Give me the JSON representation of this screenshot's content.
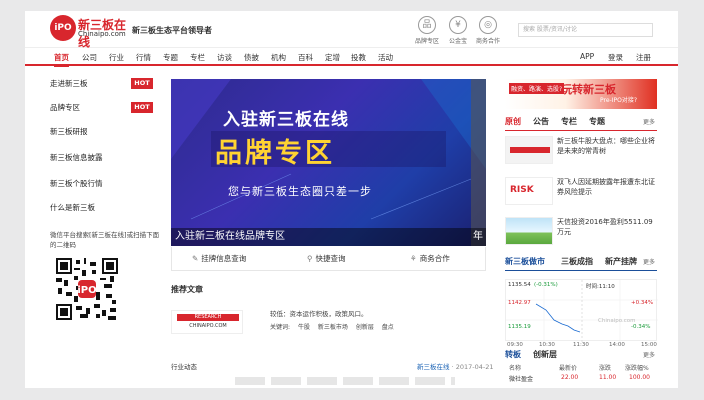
{
  "header": {
    "logo_badge": "iPO",
    "logo_cn": "新三板在线",
    "logo_en": "Chinaipo.com",
    "slogan": "新三板生态平台领导者",
    "icons": [
      {
        "name": "brand-icon",
        "glyph": "品",
        "label": "品牌专区"
      },
      {
        "name": "public-fund-icon",
        "glyph": "¥",
        "label": "公金宝"
      },
      {
        "name": "business-icon",
        "glyph": "◎",
        "label": "商务合作"
      }
    ],
    "search_placeholder": "搜索 股票/资讯/讨论"
  },
  "nav": {
    "items": [
      "首页",
      "公司",
      "行业",
      "行情",
      "专题",
      "专栏",
      "访谈",
      "债披",
      "机构",
      "百科",
      "定增",
      "投教",
      "活动"
    ],
    "right": [
      "APP",
      "登录",
      "注册"
    ]
  },
  "sidebar": {
    "items": [
      {
        "label": "走进新三板",
        "hot": true
      },
      {
        "label": "品牌专区",
        "hot": true
      },
      {
        "label": "新三板研报",
        "hot": false
      },
      {
        "label": "新三板信息披露",
        "hot": false
      },
      {
        "label": "新三板个股行情",
        "hot": false
      },
      {
        "label": "什么是新三板",
        "hot": false
      }
    ],
    "hot_label": "HOT",
    "wechat_note": "微信平台搜索[新三板在线]或扫描下面的二维码"
  },
  "banner": {
    "line1": "入驻新三板在线",
    "line2": "品牌专区",
    "line3": "您与新三板生态圈只差一步",
    "caption": "入驻新三板在线品牌专区",
    "caption_next": "年"
  },
  "actions": [
    {
      "icon": "✎",
      "label": "挂牌信息查询"
    },
    {
      "icon": "⚲",
      "label": "快捷查询"
    },
    {
      "icon": "⚘",
      "label": "商务合作"
    }
  ],
  "recommended": {
    "title": "推荐文章",
    "image_top": "RESEARCH",
    "image_bottom": "CHINAIPO.COM",
    "text": "较低：资本运作积极，政策风口。",
    "keywords_label": "关键词:",
    "keywords": [
      "牛股",
      "新三板市场",
      "创新层",
      "盘点"
    ]
  },
  "industry": {
    "title": "行业动态",
    "source": "新三板在线",
    "date": "2017-04-21"
  },
  "right": {
    "ad": {
      "tag": "融资、路演、选股?",
      "main": "玩转新三板",
      "sub": "Pre-IPO对接?"
    },
    "tabs": [
      "原创",
      "公告",
      "专栏",
      "专题"
    ],
    "more": "更多",
    "news": [
      {
        "title": "新三板牛股大盘点：哪些企业将是未来的常青树"
      },
      {
        "title": "双飞人因延期披露年报遭东北证券风险提示",
        "image_label": "RISK"
      },
      {
        "title": "天信投资2016年盈利5511.09万元"
      }
    ],
    "market_tabs": [
      "新三板做市",
      "三板成指",
      "新产挂牌"
    ],
    "stock": {
      "points": "1135.54",
      "change": "(-0.31%)",
      "time": "时间:11:10",
      "high": "1142.97",
      "low": "1135.19",
      "pct_high": "+0.34%",
      "pct_low": "-0.34%",
      "watermark": "Chinaipo.com",
      "ticks": [
        "09:30",
        "10:30",
        "11:30",
        "14:00",
        "15:00"
      ]
    },
    "board_tabs": [
      "转板",
      "创新层"
    ],
    "table_header": [
      "名称",
      "最新价",
      "涨跌",
      "涨跌幅%"
    ],
    "table_row": [
      "微社盈金",
      "22.00",
      "11.00",
      "100.00"
    ]
  }
}
